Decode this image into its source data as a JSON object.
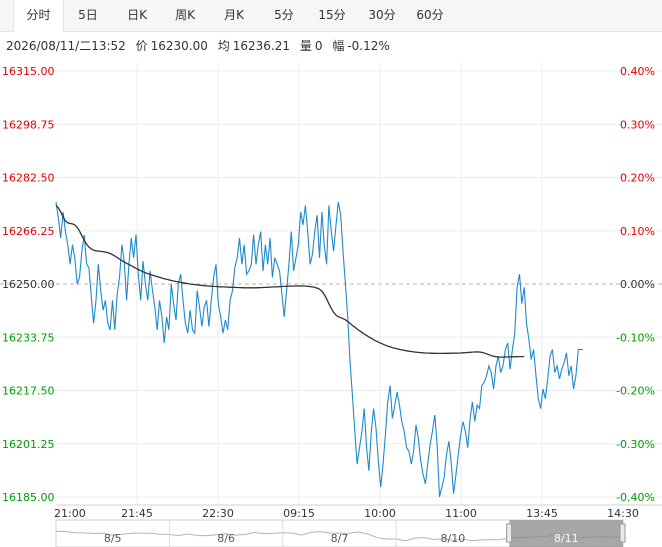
{
  "tabs": [
    {
      "label": "分时",
      "active": true
    },
    {
      "label": "5日",
      "active": false
    },
    {
      "label": "日K",
      "active": false
    },
    {
      "label": "周K",
      "active": false
    },
    {
      "label": "月K",
      "active": false
    },
    {
      "label": "5分",
      "active": false
    },
    {
      "label": "15分",
      "active": false
    },
    {
      "label": "30分",
      "active": false
    },
    {
      "label": "60分",
      "active": false
    }
  ],
  "info": {
    "datetime": "2026/08/11/二13:52",
    "price_label": "价",
    "price": "16230.00",
    "avg_label": "均",
    "avg": "16236.21",
    "vol_label": "量",
    "vol": "0",
    "chg_label": "幅",
    "chg": "-0.12%"
  },
  "colors": {
    "up": "#e60000",
    "down": "#00a000",
    "price_line": "#1f8ac9",
    "avg_line": "#333333",
    "flat": "#999999"
  },
  "chart_data": {
    "type": "line",
    "ylim": [
      16185.0,
      16315.0
    ],
    "base": 16250.0,
    "y_ticks_left": [
      "16315.00",
      "16298.75",
      "16282.50",
      "16266.25",
      "16250.00",
      "16233.75",
      "16217.50",
      "16201.25",
      "16185.00"
    ],
    "y_ticks_right": [
      "0.40%",
      "0.30%",
      "0.20%",
      "0.10%",
      "0.00%",
      "-0.10%",
      "-0.20%",
      "-0.30%",
      "-0.40%"
    ],
    "x_ticks": [
      "21:00",
      "21:45",
      "22:30",
      "09:15",
      "10:00",
      "11:00",
      "13:45",
      "14:30"
    ],
    "timeline_dates": [
      "8/5",
      "8/6",
      "8/7",
      "8/10",
      "8/11"
    ],
    "series": [
      {
        "values": [
          16275,
          16270,
          16264,
          16272,
          16266,
          16262,
          16256,
          16262,
          16258,
          16250,
          16252,
          16260,
          16265,
          16256,
          16255,
          16246,
          16238,
          16245,
          16256,
          16248,
          16242,
          16245,
          16238,
          16236,
          16245,
          16236,
          16247,
          16252,
          16262,
          16257,
          16245,
          16256,
          16264,
          16258,
          16265,
          16253,
          16245,
          16257,
          16250,
          16245,
          16254,
          16248,
          16243,
          16236,
          16245,
          16240,
          16232,
          16240,
          16236,
          16250,
          16244,
          16239,
          16250,
          16253,
          16245,
          16238,
          16235,
          16242,
          16236,
          16235,
          16248,
          16243,
          16237,
          16243,
          16245,
          16237,
          16245,
          16252,
          16256,
          16244,
          16240,
          16235,
          16239,
          16236,
          16245,
          16248,
          16255,
          16258,
          16264,
          16256,
          16262,
          16253,
          16254,
          16256,
          16265,
          16256,
          16262,
          16266,
          16254,
          16262,
          16256,
          16264,
          16252,
          16258,
          16256,
          16254,
          16247,
          16240,
          16248,
          16256,
          16266,
          16254,
          16258,
          16262,
          16272,
          16268,
          16274,
          16266,
          16256,
          16259,
          16266,
          16271,
          16258,
          16272,
          16262,
          16256,
          16274,
          16266,
          16260,
          16268,
          16275,
          16271,
          16260,
          16250,
          16240,
          16226,
          16216,
          16205,
          16195,
          16200,
          16205,
          16212,
          16200,
          16193,
          16205,
          16212,
          16206,
          16196,
          16188,
          16195,
          16204,
          16214,
          16219,
          16209,
          16213,
          16217,
          16213,
          16208,
          16205,
          16200,
          16199,
          16195,
          16199,
          16207,
          16203,
          16196,
          16192,
          16189,
          16195,
          16201,
          16205,
          16210,
          16201,
          16185,
          16188,
          16191,
          16198,
          16202,
          16195,
          16186,
          16192,
          16198,
          16204,
          16208,
          16205,
          16200,
          16209,
          16214,
          16208,
          16213,
          16212,
          16219,
          16220,
          16222,
          16225,
          16223,
          16218,
          16225,
          16228,
          16223,
          16225,
          16230,
          16232,
          16224,
          16230,
          16235,
          16249,
          16253,
          16244,
          16249,
          16238,
          16233,
          16227,
          16230,
          16222,
          16215,
          16212,
          16218,
          16215,
          16221,
          16228,
          16230,
          16223,
          16225,
          16221,
          16224,
          16226,
          16229,
          16222,
          16225,
          16218,
          16222,
          16230,
          16230,
          16230
        ]
      },
      {
        "values": [
          16273.99,
          16273.22,
          16272.04,
          16270.49,
          16269.27,
          16268.66,
          16268.45,
          16268.33,
          16268.05,
          16267.3,
          16266.13,
          16264.71,
          16263.33,
          16262.17,
          16261.3,
          16260.7,
          16260.34,
          16260.14,
          16260.03,
          16259.96,
          16259.88,
          16259.75,
          16259.57,
          16259.3,
          16258.95,
          16258.53,
          16258.06,
          16257.59,
          16257.13,
          16256.71,
          16256.32,
          16255.94,
          16255.57,
          16255.19,
          16254.8,
          16254.42,
          16254.05,
          16253.72,
          16253.43,
          16253.17,
          16252.94,
          16252.71,
          16252.48,
          16252.25,
          16252.03,
          16251.82,
          16251.61,
          16251.42,
          16251.24,
          16251.07,
          16250.92,
          16250.77,
          16250.63,
          16250.5,
          16250.37,
          16250.24,
          16250.12,
          16250.01,
          16249.91,
          16249.81,
          16249.72,
          16249.64,
          16249.56,
          16249.49,
          16249.43,
          16249.37,
          16249.32,
          16249.27,
          16249.23,
          16249.19,
          16249.15,
          16249.12,
          16249.09,
          16249.06,
          16249.03,
          16249.0,
          16248.96,
          16248.93,
          16248.9,
          16248.87,
          16248.85,
          16248.83,
          16248.83,
          16248.83,
          16248.84,
          16248.85,
          16248.87,
          16248.89,
          16248.92,
          16248.96,
          16249.0,
          16249.04,
          16249.08,
          16249.12,
          16249.16,
          16249.2,
          16249.24,
          16249.28,
          16249.32,
          16249.35,
          16249.37,
          16249.39,
          16249.4,
          16249.41,
          16249.4,
          16249.38,
          16249.35,
          16249.3,
          16249.22,
          16249.11,
          16248.96,
          16248.74,
          16248.4,
          16247.81,
          16246.81,
          16245.47,
          16244.0,
          16242.57,
          16241.36,
          16240.51,
          16240.02,
          16239.72,
          16239.44,
          16239.06,
          16238.55,
          16237.97,
          16237.38,
          16236.81,
          16236.27,
          16235.76,
          16235.26,
          16234.77,
          16234.3,
          16233.85,
          16233.42,
          16233.01,
          16232.63,
          16232.27,
          16231.93,
          16231.62,
          16231.33,
          16231.06,
          16230.82,
          16230.6,
          16230.4,
          16230.22,
          16230.05,
          16229.9,
          16229.76,
          16229.62,
          16229.5,
          16229.39,
          16229.29,
          16229.2,
          16229.12,
          16229.06,
          16229.0,
          16228.95,
          16228.91,
          16228.88,
          16228.86,
          16228.84,
          16228.83,
          16228.82,
          16228.82,
          16228.83,
          16228.84,
          16228.86,
          16228.87,
          16228.88,
          16228.9,
          16228.92,
          16228.95,
          16228.99,
          16229.04,
          16229.1,
          16229.16,
          16229.22,
          16229.26,
          16229.27,
          16229.24,
          16229.13,
          16228.95,
          16228.71,
          16228.43,
          16228.16,
          16227.95,
          16227.81,
          16227.73,
          16227.7,
          16227.7,
          16227.71,
          16227.73,
          16227.75,
          16227.77,
          16227.79,
          16227.81,
          16227.83,
          16227.86,
          16227.89
        ]
      }
    ]
  }
}
